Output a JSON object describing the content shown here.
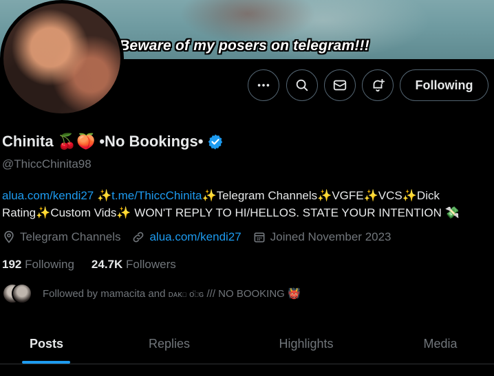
{
  "banner": {
    "caption": "Beware of my posers on telegram!!!"
  },
  "actions": {
    "follow_label": "Following"
  },
  "profile": {
    "display_name_part1": "Chinita",
    "display_name_part2": "•No Bookings•",
    "emoji": "🍒🍑",
    "handle": "@ThiccChinita98",
    "verified_color": "#1d9bf0"
  },
  "bio": {
    "link1": "alua.com/kendi27",
    "link2": "t.me/ThiccChinita",
    "text_after_link2": "Telegram Channels",
    "text_vgfe": "VGFE",
    "text_vcs": "VCS",
    "text_dick": "Dick Rating",
    "text_custom": "Custom Vids",
    "text_last": " WON'T REPLY TO HI/HELLOS. STATE YOUR INTENTION ",
    "sparkle": "✨",
    "money": "💸"
  },
  "meta": {
    "location": "Telegram Channels",
    "website": "alua.com/kendi27",
    "joined": "Joined November 2023"
  },
  "stats": {
    "following_count": "192",
    "following_label": "Following",
    "followers_count": "24.7K",
    "followers_label": "Followers"
  },
  "followed_by": {
    "prefix": "Followed by mamacita and ",
    "name2": "ᴅᴀᴋɪ ᴏ̈ɪ̈ɢ",
    "suffix": " /// NO BOOKING ",
    "emoji": "👹"
  },
  "tabs": [
    "Posts",
    "Replies",
    "Highlights",
    "Media"
  ],
  "colors": {
    "accent": "#1d9bf0",
    "muted": "#71767b",
    "text": "#e7e9ea"
  }
}
